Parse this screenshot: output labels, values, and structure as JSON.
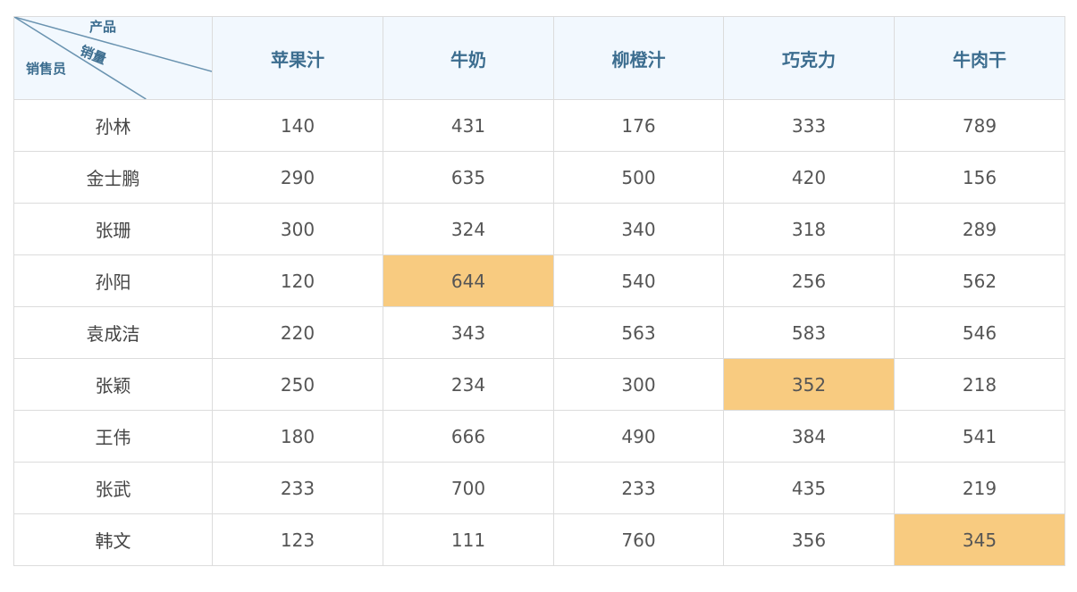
{
  "table": {
    "corner": {
      "top_label": "产品",
      "middle_label": "销量",
      "bottom_label": "销售员"
    },
    "columns": [
      "苹果汁",
      "牛奶",
      "柳橙汁",
      "巧克力",
      "牛肉干"
    ],
    "rows": [
      {
        "name": "孙林",
        "values": [
          "140",
          "431",
          "176",
          "333",
          "789"
        ],
        "highlight": -1
      },
      {
        "name": "金士鹏",
        "values": [
          "290",
          "635",
          "500",
          "420",
          "156"
        ],
        "highlight": -1
      },
      {
        "name": "张珊",
        "values": [
          "300",
          "324",
          "340",
          "318",
          "289"
        ],
        "highlight": -1
      },
      {
        "name": "孙阳",
        "values": [
          "120",
          "644",
          "540",
          "256",
          "562"
        ],
        "highlight": 1
      },
      {
        "name": "袁成洁",
        "values": [
          "220",
          "343",
          "563",
          "583",
          "546"
        ],
        "highlight": -1
      },
      {
        "name": "张颖",
        "values": [
          "250",
          "234",
          "300",
          "352",
          "218"
        ],
        "highlight": 3
      },
      {
        "name": "王伟",
        "values": [
          "180",
          "666",
          "490",
          "384",
          "541"
        ],
        "highlight": -1
      },
      {
        "name": "张武",
        "values": [
          "233",
          "700",
          "233",
          "435",
          "219"
        ],
        "highlight": -1
      },
      {
        "name": "韩文",
        "values": [
          "123",
          "111",
          "760",
          "356",
          "345"
        ],
        "highlight": 4
      }
    ],
    "colors": {
      "header_bg": "#f2f8fe",
      "header_text": "#3c6d8f",
      "highlight_bg": "#f8cb80",
      "border": "#dcdcdc"
    }
  }
}
